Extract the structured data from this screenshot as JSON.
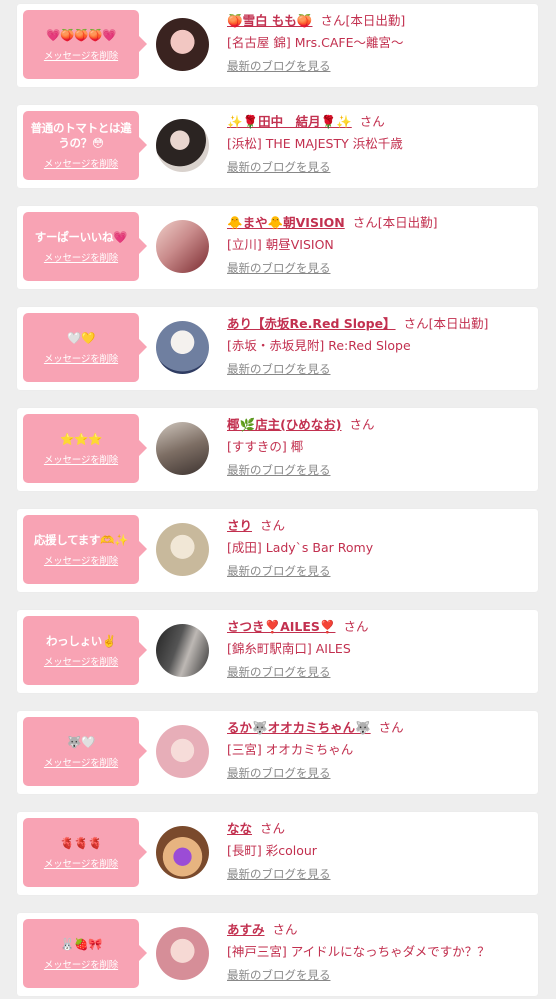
{
  "delete_label": "メッセージを削除",
  "blog_link_label": "最新のブログを見る",
  "honorific": "さん",
  "colors": {
    "accent": "#c2304f",
    "bubble": "#f8a3b4",
    "background": "#eeeeee",
    "link_gray": "#888888"
  },
  "cards": [
    {
      "message": "💗🍑🍑🍑💗",
      "name": "🍑雪白 もも🍑",
      "status": "[本日出勤]",
      "shop": "[名古屋 錦] Mrs.CAFE〜離宮〜"
    },
    {
      "message": "普通のトマトとは違うの？😳",
      "name": "✨🌹田中　結月🌹✨",
      "status": "",
      "shop": "[浜松] THE MAJESTY 浜松千歳"
    },
    {
      "message": "すーぱーいいね💗",
      "name": "🐥まや🐥朝VISION",
      "status": "[本日出勤]",
      "shop": "[立川] 朝昼VISION"
    },
    {
      "message": "🤍💛",
      "name": "あり【赤坂Re.Red Slope】",
      "status": "[本日出勤]",
      "shop": "[赤坂・赤坂見附] Re:Red Slope"
    },
    {
      "message": "⭐️⭐️⭐️",
      "name": "椰🌿店主(ひめなお)",
      "status": "",
      "shop": "[すすきの] 椰"
    },
    {
      "message": "応援してます🫶✨",
      "name": "さり",
      "status": "",
      "shop": "[成田] Lady`s Bar Romy"
    },
    {
      "message": "わっしょい✌️",
      "name": "さつき❣️AILES❣️",
      "status": "",
      "shop": "[錦糸町駅南口] AILES"
    },
    {
      "message": "🐺🤍",
      "name": "るか🐺オオカミちゃん🐺",
      "status": "",
      "shop": "[三宮] オオカミちゃん"
    },
    {
      "message": "🫀🫀🫀",
      "name": "なな",
      "status": "",
      "shop": "[長町] 彩colour"
    },
    {
      "message": "🐰🍓🎀",
      "name": "あすみ",
      "status": "",
      "shop": "[神戸三宮] アイドルになっちゃダメですか？？"
    }
  ]
}
